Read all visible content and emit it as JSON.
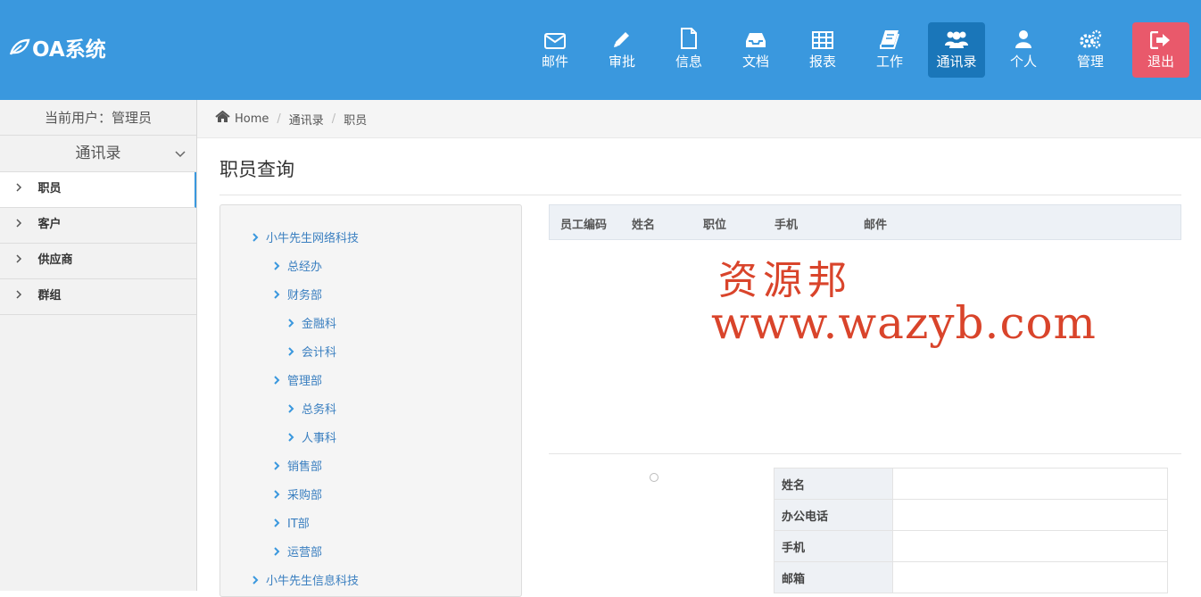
{
  "app": {
    "logo_text": "OA系统"
  },
  "nav": [
    {
      "label": "邮件",
      "icon": "envelope-icon"
    },
    {
      "label": "审批",
      "icon": "pencil-icon"
    },
    {
      "label": "信息",
      "icon": "file-icon"
    },
    {
      "label": "文档",
      "icon": "inbox-icon"
    },
    {
      "label": "报表",
      "icon": "table-icon"
    },
    {
      "label": "工作",
      "icon": "book-icon"
    },
    {
      "label": "通讯录",
      "icon": "users-icon",
      "active": true
    },
    {
      "label": "个人",
      "icon": "user-icon"
    },
    {
      "label": "管理",
      "icon": "gears-icon"
    },
    {
      "label": "退出",
      "icon": "sign-out-icon"
    }
  ],
  "sidebar": {
    "current_user": "当前用户：管理员",
    "section": "通讯录",
    "items": [
      {
        "label": "职员",
        "active": true
      },
      {
        "label": "客户"
      },
      {
        "label": "供应商"
      },
      {
        "label": "群组"
      }
    ]
  },
  "breadcrumb": {
    "home": "Home",
    "level1": "通讯录",
    "level2": "职员"
  },
  "main": {
    "title": "职员查询",
    "tree": [
      "小牛先生网络科技",
      "总经办",
      "财务部",
      "金融科",
      "会计科",
      "管理部",
      "总务科",
      "人事科",
      "销售部",
      "采购部",
      "IT部",
      "运营部",
      "小牛先生信息科技"
    ],
    "table_headers": [
      "员工编码",
      "姓名",
      "职位",
      "手机",
      "邮件"
    ],
    "detail_labels": [
      "姓名",
      "办公电话",
      "手机",
      "邮箱"
    ]
  },
  "watermark": {
    "line1": "资源邦",
    "line2": "www.wazyb.com"
  },
  "colors": {
    "header": "#3a98de",
    "active_nav": "#1a76b9",
    "logout": "#e9596b",
    "link": "#3a7fc0",
    "watermark": "#d9442b"
  }
}
